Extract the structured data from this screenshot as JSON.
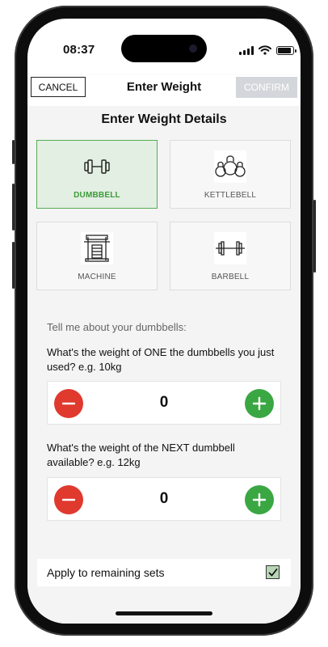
{
  "status_bar": {
    "time": "08:37"
  },
  "nav": {
    "cancel_label": "CANCEL",
    "title": "Enter Weight",
    "confirm_label": "CONFIRM"
  },
  "section_title": "Enter Weight Details",
  "equipment": [
    {
      "label": "DUMBBELL",
      "icon": "dumbbell-icon",
      "selected": true
    },
    {
      "label": "KETTLEBELL",
      "icon": "kettlebell-icon",
      "selected": false
    },
    {
      "label": "MACHINE",
      "icon": "machine-icon",
      "selected": false
    },
    {
      "label": "BARBELL",
      "icon": "barbell-icon",
      "selected": false
    }
  ],
  "prompt": "Tell me about your dumbbells:",
  "questions": [
    {
      "text": "What's the weight of ONE the dumbbells you just used? e.g. 10kg",
      "value": "0"
    },
    {
      "text": "What's the weight of the NEXT dumbbell available? e.g. 12kg",
      "value": "0"
    }
  ],
  "apply_remaining": {
    "label": "Apply to remaining sets",
    "checked": true
  },
  "colors": {
    "selected_green": "#56ad55",
    "minus_red": "#e0392e",
    "plus_green": "#3aa743",
    "confirm_disabled": "#d3d6da"
  }
}
